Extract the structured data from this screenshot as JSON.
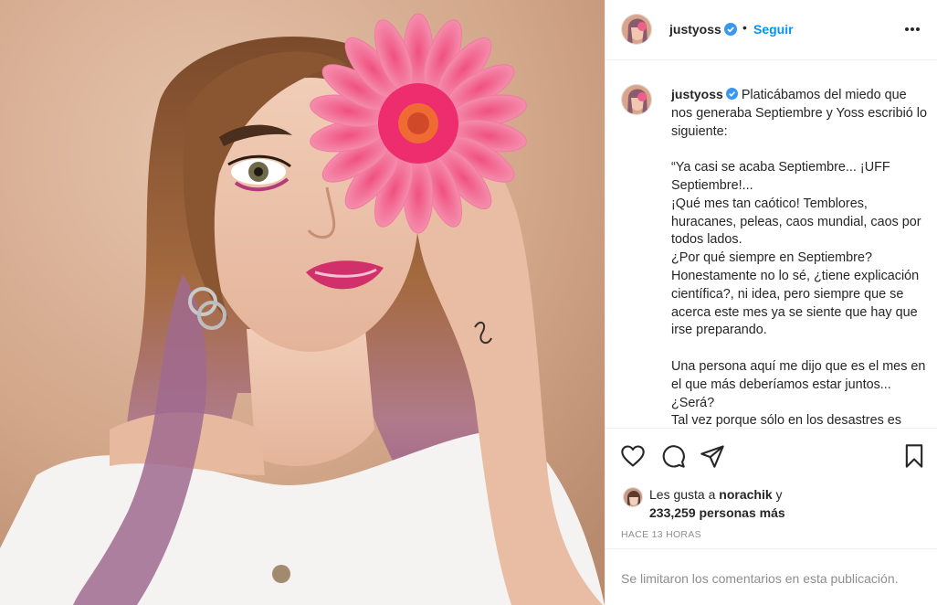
{
  "post": {
    "image_alt": "Woman with purple-tipped hair holding a pink gerbera daisy over one eye"
  },
  "header": {
    "username": "justyoss",
    "separator": "•",
    "follow_label": "Seguir",
    "more_icon": "more-horizontal-icon"
  },
  "caption": {
    "username": "justyoss",
    "text": "Platicábamos del miedo que nos generaba Septiembre y Yoss escribió lo siguiente:\n\n“Ya casi se acaba Septiembre... ¡UFF Septiembre!...\n¡Qué mes tan caótico! Temblores, huracanes, peleas, caos mundial, caos por todos lados.\n¿Por qué siempre en Septiembre? Honestamente no lo sé, ¿tiene explicación científica?, ni idea, pero siempre que se acerca este mes ya se siente que hay que irse preparando.\n\nUna persona aquí me dijo que es el mes en el que más deberíamos estar juntos... ¿Será?\nTal vez porque sólo en los desastres es"
  },
  "actions": {
    "like_icon": "heart-icon",
    "comment_icon": "comment-icon",
    "share_icon": "paper-plane-icon",
    "save_icon": "bookmark-icon"
  },
  "likes": {
    "prefix": "Les gusta a ",
    "liker": "norachik",
    "conjunction": " y",
    "count": "233,259 personas más"
  },
  "timestamp": "HACE 13 HORAS",
  "comments_limited": "Se limitaron los comentarios en esta publicación.",
  "colors": {
    "link_blue": "#0095f6",
    "verified_blue": "#3897f0",
    "muted_gray": "#8e8e8e",
    "border": "#efefef"
  }
}
